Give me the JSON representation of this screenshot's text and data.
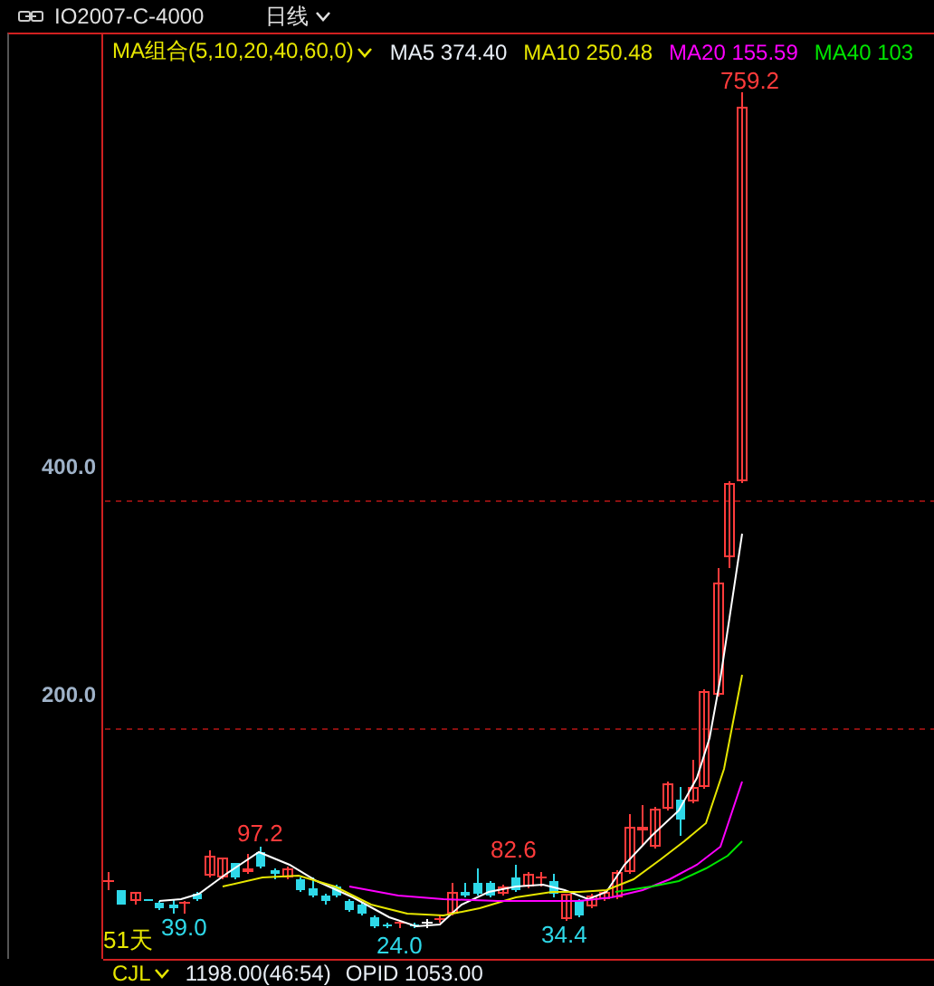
{
  "header": {
    "symbol": "IO2007-C-4000",
    "period": "日线"
  },
  "legend": {
    "title": "MA组合(5,10,20,40,60,0)",
    "items": [
      {
        "label": "MA5 374.40",
        "color": "#e8eef5"
      },
      {
        "label": "MA10 250.48",
        "color": "#e6e600"
      },
      {
        "label": "MA20 155.59",
        "color": "#ff00ff"
      },
      {
        "label": "MA40 103",
        "color": "#00e600"
      }
    ]
  },
  "y_axis": {
    "ticks": [
      "400.0",
      "200.0"
    ]
  },
  "price_labels": [
    {
      "text": "759.2",
      "kind": "high"
    },
    {
      "text": "97.2",
      "kind": "high"
    },
    {
      "text": "39.0",
      "kind": "low"
    },
    {
      "text": "24.0",
      "kind": "low"
    },
    {
      "text": "82.6",
      "kind": "high"
    },
    {
      "text": "34.4",
      "kind": "low"
    }
  ],
  "day_count": "51天",
  "indicator": {
    "name": "CJL",
    "readings": [
      "1198.00(46:54)",
      "OPID 1053.00"
    ]
  }
}
